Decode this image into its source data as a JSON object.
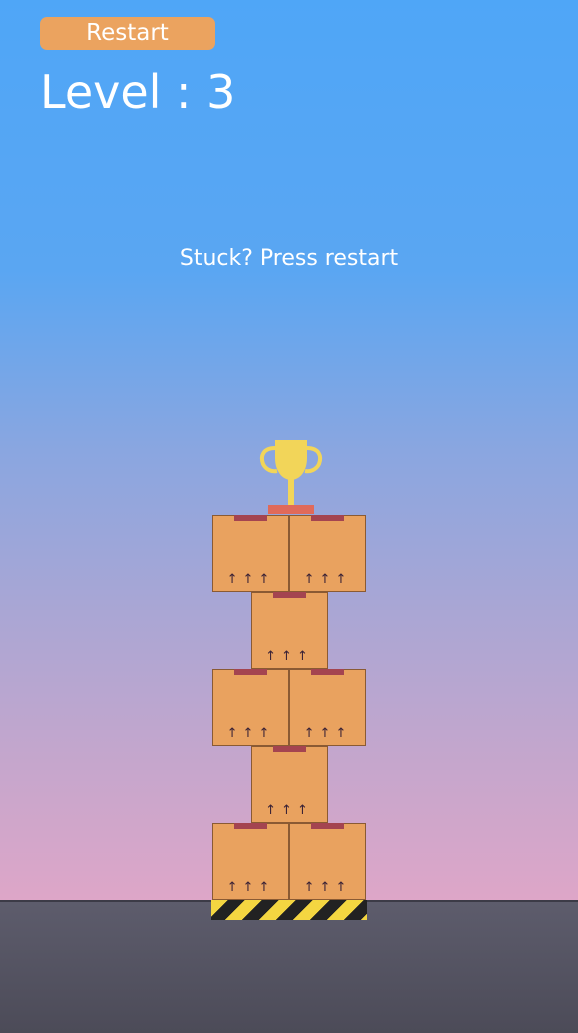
{
  "hud": {
    "restart_label": "Restart",
    "level_label": "Level : 3",
    "hint_text": "Stuck? Press restart"
  },
  "game": {
    "tower_rows_from_bottom": [
      2,
      1,
      2,
      1,
      2
    ],
    "box_marking": "↑↑↑",
    "goal": "trophy-icon",
    "base": "hazard-stripe-platform"
  },
  "colors": {
    "sky_top": "#4fa6f7",
    "sky_bottom": "#dea6c8",
    "box": "#e9a25f",
    "tape": "#a44450",
    "trophy": "#f2d559",
    "restart_button": "#eba35f",
    "ground": "#55545f"
  }
}
